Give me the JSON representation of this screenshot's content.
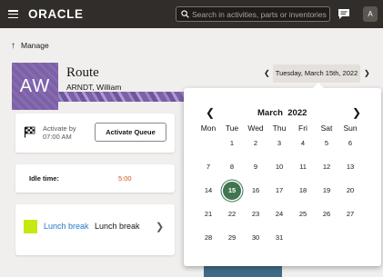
{
  "topbar": {
    "logo": "ORACLE",
    "search_placeholder": "Search in activities, parts or inventories",
    "avatar_letter": "A"
  },
  "manage": {
    "label": "Manage"
  },
  "route": {
    "initials": "AW",
    "title": "Route",
    "name": "ARNDT, William",
    "date_label": "Tuesday, March 15th, 2022",
    "avatar_color": "#7c60a8"
  },
  "activate": {
    "line1": "Activate by",
    "line2": "07:00 AM",
    "button_label": "Activate Queue"
  },
  "idle": {
    "label": "Idle time:",
    "value": "5:00"
  },
  "lunch": {
    "link": "Lunch break",
    "text": "Lunch break",
    "swatch_color": "#c6e814"
  },
  "calendar": {
    "month": "March",
    "year": "2022",
    "weekdays": [
      "Mon",
      "Tue",
      "Wed",
      "Thu",
      "Fri",
      "Sat",
      "Sun"
    ],
    "weeks": [
      [
        "",
        "1",
        "2",
        "3",
        "4",
        "5",
        "6"
      ],
      [
        "7",
        "8",
        "9",
        "10",
        "11",
        "12",
        "13"
      ],
      [
        "14",
        "15",
        "16",
        "17",
        "18",
        "19",
        "20"
      ],
      [
        "21",
        "22",
        "23",
        "24",
        "25",
        "26",
        "27"
      ],
      [
        "28",
        "29",
        "30",
        "31",
        "",
        "",
        ""
      ]
    ],
    "selected_day": "15",
    "selected_color": "#417551"
  }
}
